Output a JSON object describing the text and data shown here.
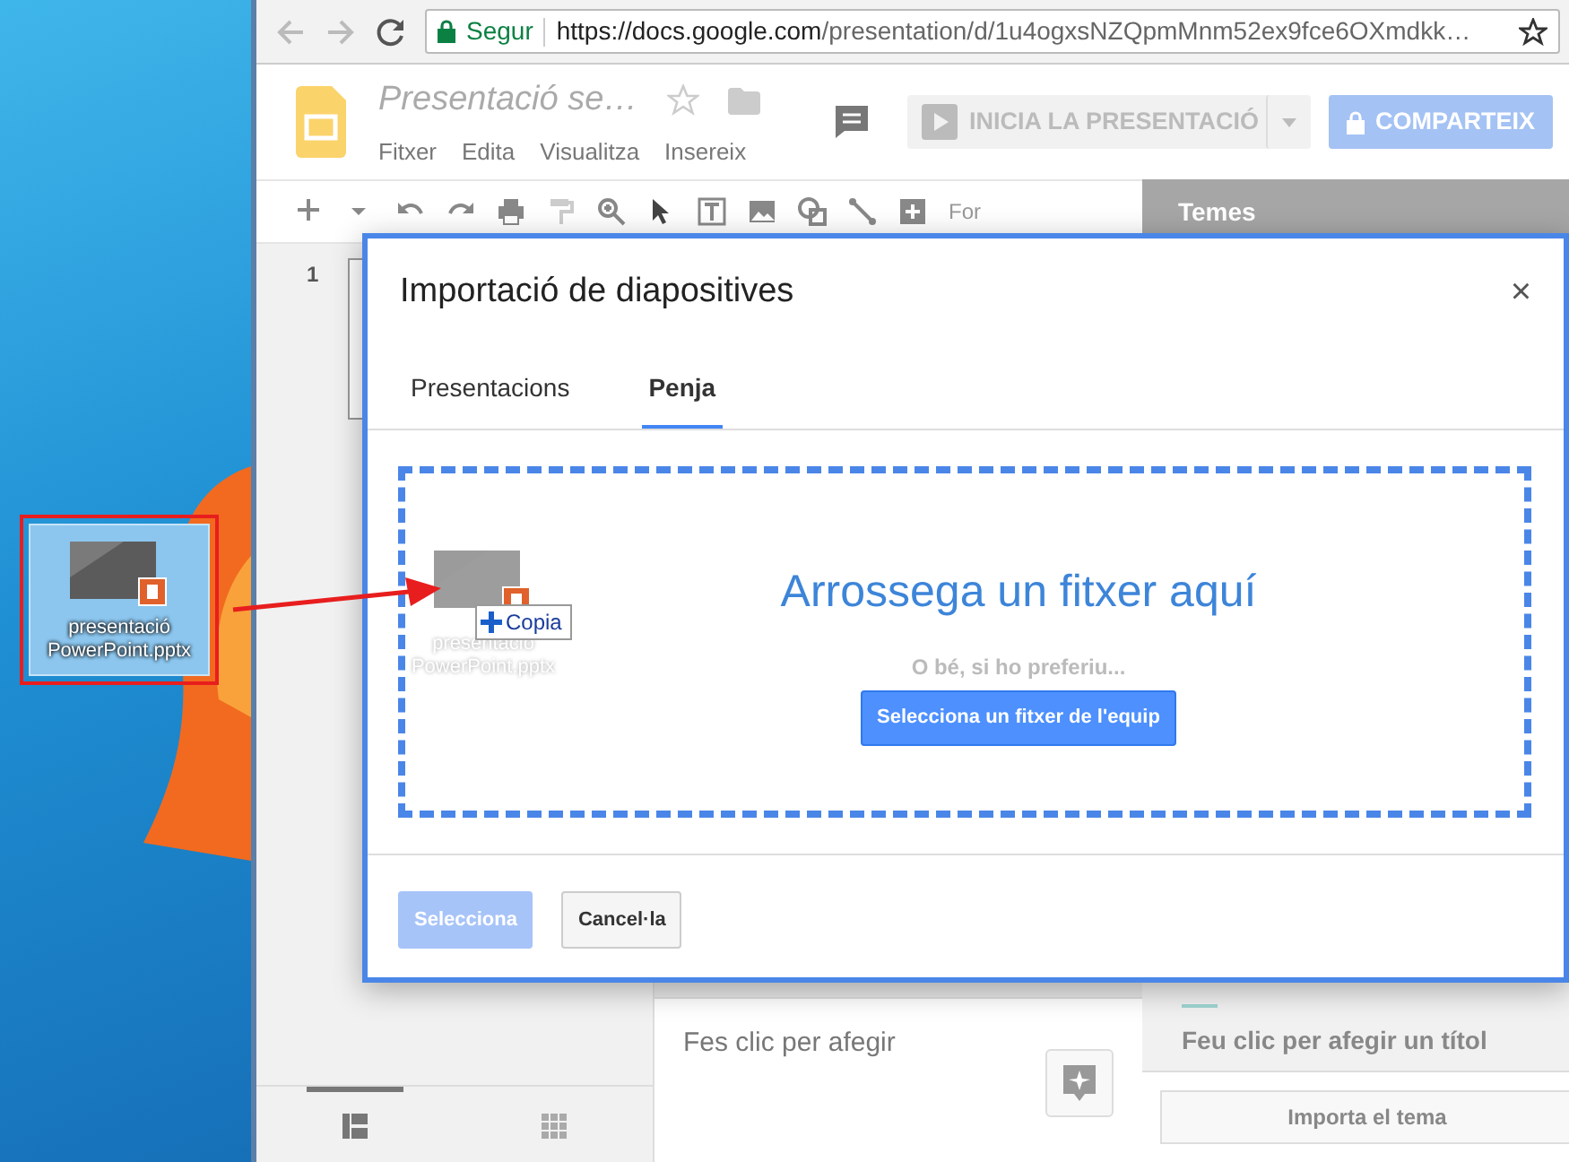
{
  "browser": {
    "secure_label": "Segur",
    "url_host": "https://docs.google.com",
    "url_path": "/presentation/d/1u4ogxsNZQpmMnm52ex9fce6OXmdkk…"
  },
  "app": {
    "title": "Presentació se…",
    "menu": [
      "Fitxer",
      "Edita",
      "Visualitza",
      "Insereix"
    ],
    "present_button": "INICIA LA PRESENTACIÓ",
    "share_button": "COMPARTEIX",
    "toolbar_text": "For"
  },
  "filmstrip": {
    "slide_number": "1",
    "views": [
      {
        "kind": "list",
        "selected": true
      },
      {
        "kind": "grid",
        "selected": false
      }
    ]
  },
  "notes": {
    "text": "Fes clic per afegir"
  },
  "themes": {
    "title": "Temes",
    "preview_title": "Feu clic per afegir un títol",
    "import_button": "Importa el tema"
  },
  "desktop": {
    "file": {
      "name": "presentació PowerPoint.pptx",
      "selected": true
    }
  },
  "drag": {
    "file_name": "presentació PowerPoint.pptx",
    "action": "Copia"
  },
  "dialog": {
    "title": "Importació de diapositives",
    "close": "×",
    "tabs": [
      {
        "label": "Presentacions",
        "selected": false
      },
      {
        "label": "Penja",
        "selected": true
      }
    ],
    "drop_title": "Arrossega un fitxer aquí",
    "drop_hint": "O bé, si ho preferiu...",
    "pick_button": "Selecciona un fitxer de l'equip",
    "buttons": [
      {
        "label": "Selecciona",
        "disabled": true
      },
      {
        "label": "Cancel·la",
        "disabled": false
      }
    ]
  }
}
